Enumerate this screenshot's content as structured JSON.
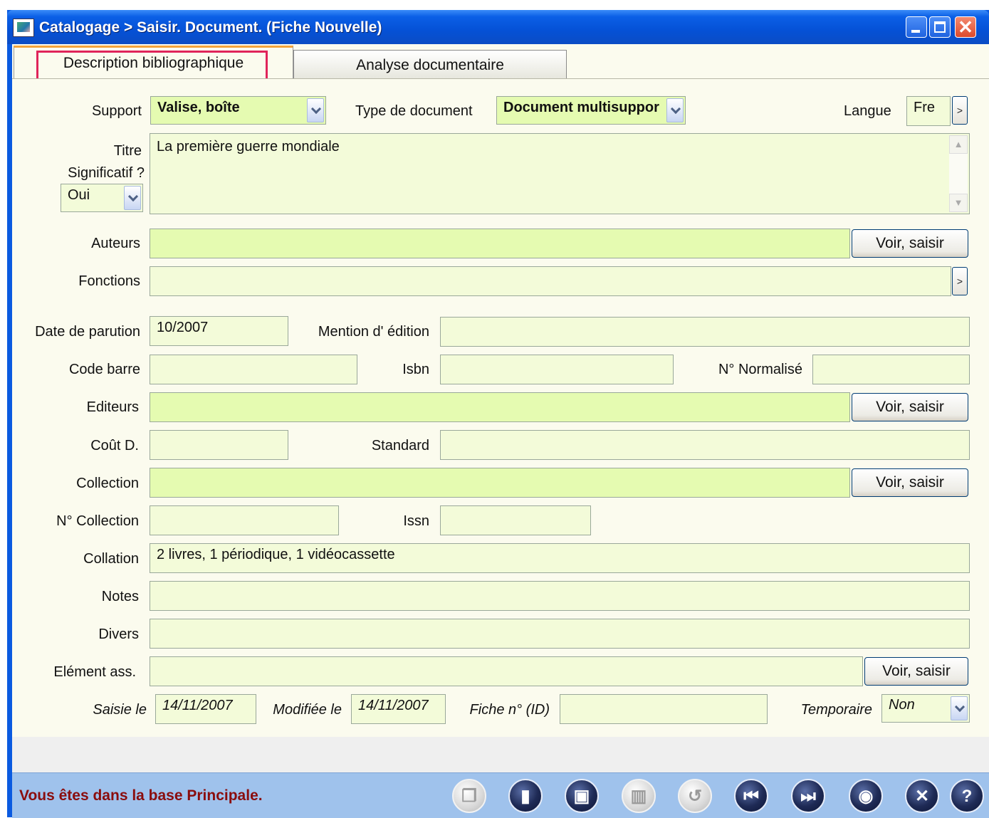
{
  "window": {
    "title": "Catalogage > Saisir. Document.  (Fiche Nouvelle)",
    "minimize_label": "",
    "maximize_label": "",
    "close_label": "✕"
  },
  "tabs": [
    {
      "label": "Description bibliographique",
      "active": true
    },
    {
      "label": "Analyse documentaire",
      "active": false
    }
  ],
  "form": {
    "support_label": "Support",
    "support_value": "Valise, boîte",
    "type_doc_label": "Type de document",
    "type_doc_value": "Document multisuppor",
    "langue_label": "Langue",
    "langue_value": "Fre",
    "titre_label": "Titre",
    "titre_value": "La première guerre mondiale",
    "significatif_label": "Significatif ?",
    "significatif_value": "Oui",
    "auteurs_label": "Auteurs",
    "auteurs_value": "",
    "fonctions_label": "Fonctions",
    "fonctions_value": "",
    "date_parution_label": "Date de parution",
    "date_parution_value": "10/2007",
    "mention_edition_label": "Mention d' édition",
    "mention_edition_value": "",
    "code_barre_label": "Code barre",
    "code_barre_value": "",
    "isbn_label": "Isbn",
    "isbn_value": "",
    "normalise_label": "N° Normalisé",
    "normalise_value": "",
    "editeurs_label": "Editeurs",
    "editeurs_value": "",
    "cout_label": "Coût D.",
    "cout_value": "",
    "standard_label": "Standard",
    "standard_value": "",
    "collection_label": "Collection",
    "collection_value": "",
    "n_collection_label": "N° Collection",
    "n_collection_value": "",
    "issn_label": "Issn",
    "issn_value": "",
    "collation_label": "Collation",
    "collation_value": "2 livres, 1 périodique, 1 vidéocassette",
    "notes_label": "Notes",
    "notes_value": "",
    "divers_label": "Divers",
    "divers_value": "",
    "element_label": "Elément ass.",
    "element_value": "",
    "saisie_label": "Saisie le",
    "saisie_value": "14/11/2007",
    "modifiee_label": "Modifiée le",
    "modifiee_value": "14/11/2007",
    "fiche_label": "Fiche n° (ID)",
    "fiche_value": "",
    "temporaire_label": "Temporaire",
    "temporaire_value": "Non",
    "voir_saisir_label": "Voir, saisir",
    "more_label": ">"
  },
  "status": {
    "text": "Vous êtes dans la base Principale."
  },
  "toolbar": {
    "icons": [
      {
        "name": "copy-icon",
        "glyph": "❐",
        "enabled": false
      },
      {
        "name": "book-icon",
        "glyph": "▮",
        "enabled": true
      },
      {
        "name": "save-icon",
        "glyph": "▣",
        "enabled": true
      },
      {
        "name": "delete-icon",
        "glyph": "▥",
        "enabled": false
      },
      {
        "name": "undo-icon",
        "glyph": "↺",
        "enabled": false
      },
      {
        "name": "first-record-icon",
        "glyph": "⏮",
        "enabled": true
      },
      {
        "name": "last-record-icon",
        "glyph": "⏭",
        "enabled": true
      },
      {
        "name": "view-icon",
        "glyph": "◉",
        "enabled": true
      },
      {
        "name": "close-icon",
        "glyph": "✕",
        "enabled": true
      },
      {
        "name": "help-icon",
        "glyph": "?",
        "enabled": true
      }
    ]
  },
  "colors": {
    "field_bg": "#f3fbd9",
    "field_required_bg": "#e5fbb1",
    "panel_bg": "#fbfbee",
    "status_text": "#8a0d0d",
    "status_bar": "#9fc2ec",
    "tab_highlight": "#e0245a"
  }
}
